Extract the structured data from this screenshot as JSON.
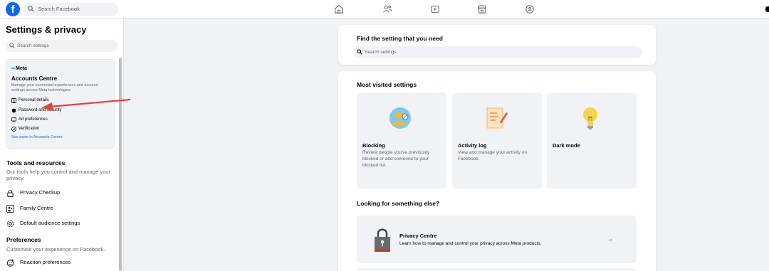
{
  "topbar": {
    "logo": "f",
    "search_placeholder": "Search Facebook",
    "nav_icons": [
      "home-icon",
      "friends-icon",
      "video-icon",
      "marketplace-icon",
      "groups-icon"
    ]
  },
  "sidebar": {
    "title": "Settings & privacy",
    "search_placeholder": "Search settings",
    "accounts_centre": {
      "brand": "Meta",
      "title": "Accounts Centre",
      "description": "Manage your connected experiences and account settings across Meta technologies.",
      "links": [
        {
          "label": "Personal details",
          "icon": "id-card-icon"
        },
        {
          "label": "Password and security",
          "icon": "shield-icon"
        },
        {
          "label": "Ad preferences",
          "icon": "monitor-icon"
        },
        {
          "label": "Verification",
          "icon": "check-circle-icon"
        }
      ],
      "more_label": "See more in Accounts Centre"
    },
    "tools": {
      "title": "Tools and resources",
      "description": "Our tools help you control and manage your privacy.",
      "items": [
        {
          "label": "Privacy Checkup",
          "icon": "lock-icon"
        },
        {
          "label": "Family Centre",
          "icon": "family-icon"
        },
        {
          "label": "Default audience settings",
          "icon": "gear-icon"
        }
      ]
    },
    "preferences": {
      "title": "Preferences",
      "description": "Customise your experience on Facebook.",
      "items": [
        {
          "label": "Reaction preferences",
          "icon": "reaction-icon"
        }
      ]
    }
  },
  "main": {
    "find": {
      "title": "Find the setting that you need",
      "search_placeholder": "Search settings"
    },
    "most_visited": {
      "title": "Most visited settings",
      "tiles": [
        {
          "title": "Blocking",
          "description": "Review people you've previously blocked or add someone to your blocked list.",
          "icon": "blocking-icon"
        },
        {
          "title": "Activity log",
          "description": "View and manage your activity on Facebook.",
          "icon": "activity-log-icon"
        },
        {
          "title": "Dark mode",
          "description": "",
          "icon": "lightbulb-icon"
        }
      ]
    },
    "looking": {
      "title": "Looking for something else?",
      "privacy_centre": {
        "title": "Privacy Centre",
        "description": "Learn how to manage and control your privacy across Meta products.",
        "arrow": "→"
      }
    }
  },
  "colors": {
    "brand": "#0866ff",
    "background": "#f0f2f5",
    "annotation_arrow": "#e8413c"
  }
}
